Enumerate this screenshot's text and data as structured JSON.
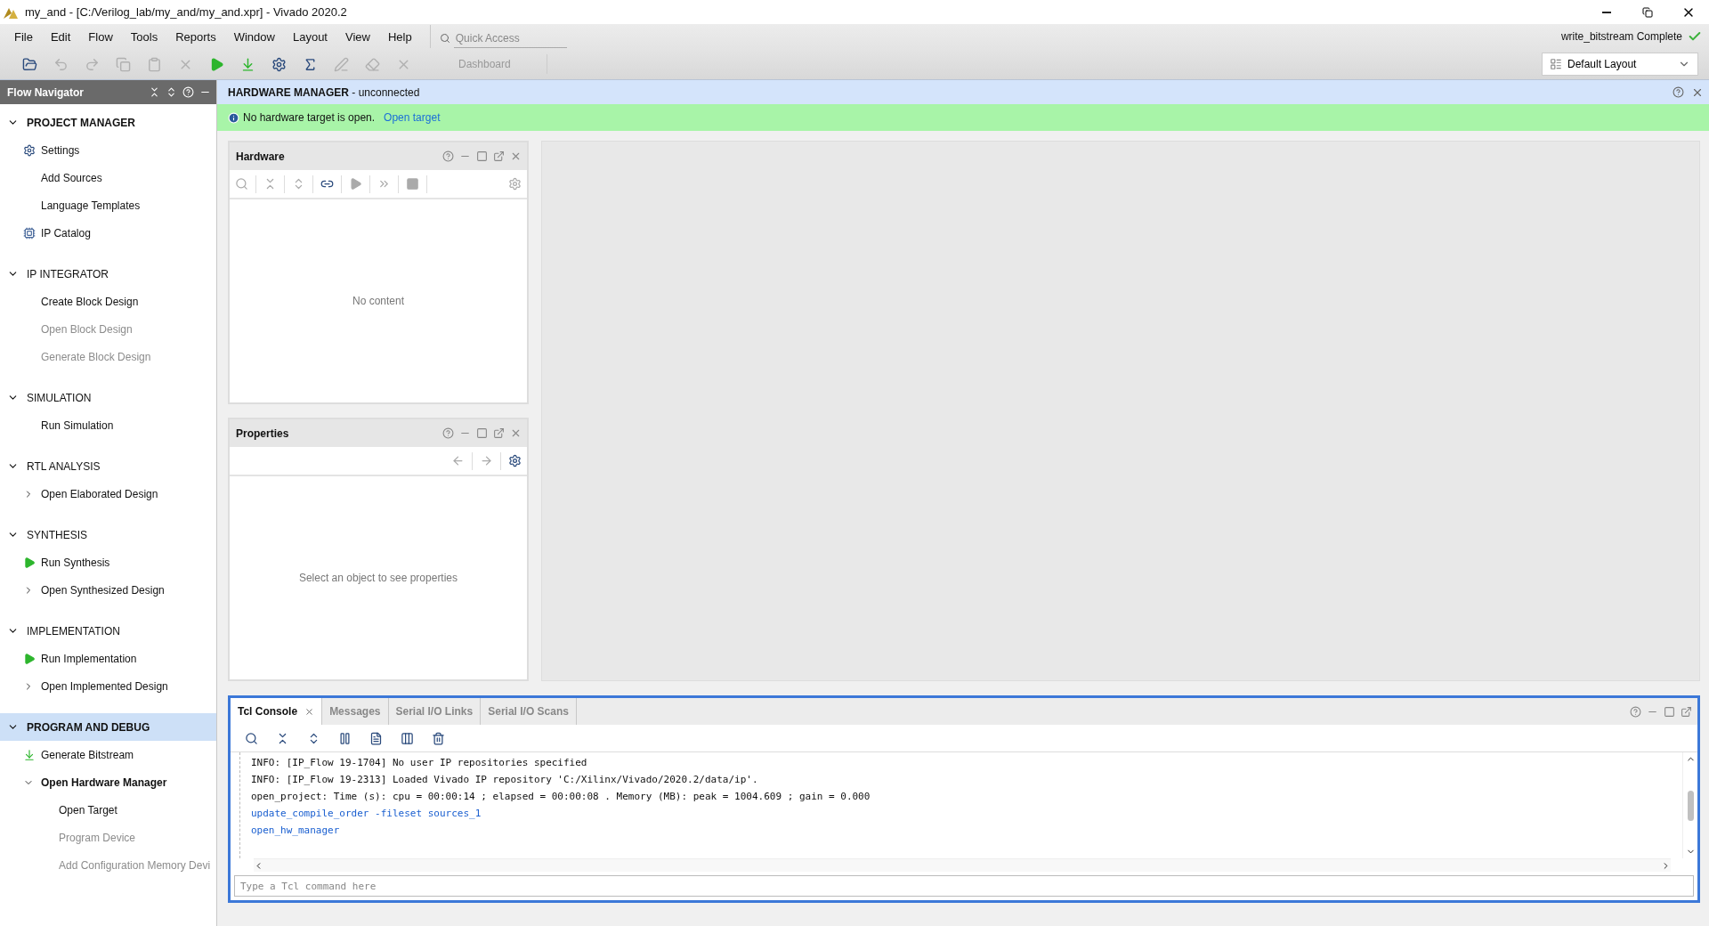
{
  "window": {
    "title": "my_and - [C:/Verilog_lab/my_and/my_and.xpr] - Vivado 2020.2"
  },
  "menu": [
    "File",
    "Edit",
    "Flow",
    "Tools",
    "Reports",
    "Window",
    "Layout",
    "View",
    "Help"
  ],
  "quick_access": {
    "placeholder": "Quick Access"
  },
  "toolbar": [
    {
      "kind": "folder",
      "disabled": false
    },
    {
      "kind": "undo",
      "disabled": true
    },
    {
      "kind": "redo",
      "disabled": true
    },
    {
      "kind": "copy",
      "disabled": true
    },
    {
      "kind": "paste",
      "disabled": true
    },
    {
      "kind": "delete",
      "disabled": true
    },
    {
      "kind": "run",
      "disabled": false
    },
    {
      "kind": "bitstream",
      "disabled": false
    },
    {
      "kind": "settings",
      "disabled": false
    },
    {
      "kind": "sigma",
      "disabled": false
    },
    {
      "kind": "pen",
      "disabled": true
    },
    {
      "kind": "eraser",
      "disabled": true
    },
    {
      "kind": "cross",
      "disabled": true
    }
  ],
  "dashboard": {
    "label": "Dashboard",
    "disabled": true
  },
  "status": {
    "text": "write_bitstream Complete",
    "complete": true
  },
  "layout_select": {
    "value": "Default Layout"
  },
  "flow_navigator": {
    "title": "Flow Navigator",
    "sections": [
      {
        "label": "PROJECT MANAGER",
        "expanded": true,
        "selected": false,
        "bold": true,
        "items": [
          {
            "label": "Settings",
            "kind": "gear",
            "disabled": false,
            "bold": false
          },
          {
            "label": "Add Sources",
            "kind": "plain",
            "disabled": false,
            "bold": false
          },
          {
            "label": "Language Templates",
            "kind": "plain",
            "disabled": false,
            "bold": false
          },
          {
            "label": "IP Catalog",
            "kind": "chip",
            "disabled": false,
            "bold": false
          }
        ]
      },
      {
        "label": "IP INTEGRATOR",
        "expanded": true,
        "selected": false,
        "bold": false,
        "items": [
          {
            "label": "Create Block Design",
            "kind": "plain",
            "disabled": false,
            "bold": false
          },
          {
            "label": "Open Block Design",
            "kind": "plain",
            "disabled": true,
            "bold": false
          },
          {
            "label": "Generate Block Design",
            "kind": "plain",
            "disabled": true,
            "bold": false
          }
        ]
      },
      {
        "label": "SIMULATION",
        "expanded": true,
        "selected": false,
        "bold": false,
        "items": [
          {
            "label": "Run Simulation",
            "kind": "plain",
            "disabled": false,
            "bold": false
          }
        ]
      },
      {
        "label": "RTL ANALYSIS",
        "expanded": true,
        "selected": false,
        "bold": false,
        "items": [
          {
            "label": "Open Elaborated Design",
            "kind": "expandable",
            "disabled": false,
            "bold": false,
            "expanded": false
          }
        ]
      },
      {
        "label": "SYNTHESIS",
        "expanded": true,
        "selected": false,
        "bold": false,
        "items": [
          {
            "label": "Run Synthesis",
            "kind": "run",
            "disabled": false,
            "bold": false
          },
          {
            "label": "Open Synthesized Design",
            "kind": "expandable",
            "disabled": false,
            "bold": false,
            "expanded": false
          }
        ]
      },
      {
        "label": "IMPLEMENTATION",
        "expanded": true,
        "selected": false,
        "bold": false,
        "items": [
          {
            "label": "Run Implementation",
            "kind": "run",
            "disabled": false,
            "bold": false
          },
          {
            "label": "Open Implemented Design",
            "kind": "expandable",
            "disabled": false,
            "bold": false,
            "expanded": false
          }
        ]
      },
      {
        "label": "PROGRAM AND DEBUG",
        "expanded": true,
        "selected": true,
        "bold": true,
        "items": [
          {
            "label": "Generate Bitstream",
            "kind": "bitstream",
            "disabled": false,
            "bold": false
          },
          {
            "label": "Open Hardware Manager",
            "kind": "expandable",
            "disabled": false,
            "bold": true,
            "expanded": true,
            "children": [
              {
                "label": "Open Target",
                "kind": "plain",
                "disabled": false,
                "bold": false
              },
              {
                "label": "Program Device",
                "kind": "plain",
                "disabled": true,
                "bold": false
              },
              {
                "label": "Add Configuration Memory Devi",
                "kind": "plain",
                "disabled": true,
                "bold": false
              }
            ]
          }
        ]
      }
    ]
  },
  "hardware_manager": {
    "title": "HARDWARE MANAGER",
    "state": " - unconnected",
    "banner": {
      "text": "No hardware target is open.",
      "link": "Open target"
    }
  },
  "hardware_panel": {
    "title": "Hardware",
    "empty": "No content"
  },
  "properties_panel": {
    "title": "Properties",
    "empty": "Select an object to see properties"
  },
  "console": {
    "tabs": [
      {
        "label": "Tcl Console",
        "selected": true,
        "closable": true
      },
      {
        "label": "Messages",
        "selected": false,
        "closable": false
      },
      {
        "label": "Serial I/O Links",
        "selected": false,
        "closable": false
      },
      {
        "label": "Serial I/O Scans",
        "selected": false,
        "closable": false
      }
    ],
    "lines": [
      {
        "text": "INFO: [IP_Flow 19-1704] No user IP repositories specified",
        "kind": "info"
      },
      {
        "text": "INFO: [IP_Flow 19-2313] Loaded Vivado IP repository 'C:/Xilinx/Vivado/2020.2/data/ip'.",
        "kind": "info"
      },
      {
        "text": "open_project: Time (s): cpu = 00:00:14 ; elapsed = 00:00:08 . Memory (MB): peak = 1004.609 ; gain = 0.000",
        "kind": "result"
      },
      {
        "text": "update_compile_order -fileset sources_1",
        "kind": "command"
      },
      {
        "text": "open_hw_manager",
        "kind": "command"
      }
    ],
    "input": {
      "placeholder": "Type a Tcl command here"
    }
  }
}
